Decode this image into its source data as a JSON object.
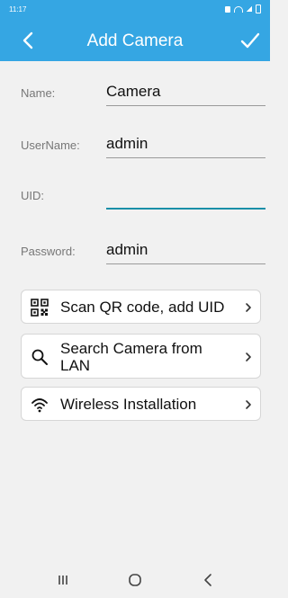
{
  "status": {
    "time": "11:17"
  },
  "header": {
    "title": "Add Camera"
  },
  "form": {
    "name_label": "Name:",
    "name_value": "Camera",
    "username_label": "UserName:",
    "username_value": "admin",
    "uid_label": "UID:",
    "uid_value": "",
    "password_label": "Password:",
    "password_value": "admin"
  },
  "actions": [
    {
      "label": "Scan QR code, add UID",
      "icon": "qr-code-icon"
    },
    {
      "label": "Search Camera from LAN",
      "icon": "search-icon"
    },
    {
      "label": "Wireless Installation",
      "icon": "wifi-icon"
    }
  ],
  "colors": {
    "accent": "#35a6e3",
    "background": "#f1f1f1",
    "focus_underline": "#1a8fa8"
  }
}
